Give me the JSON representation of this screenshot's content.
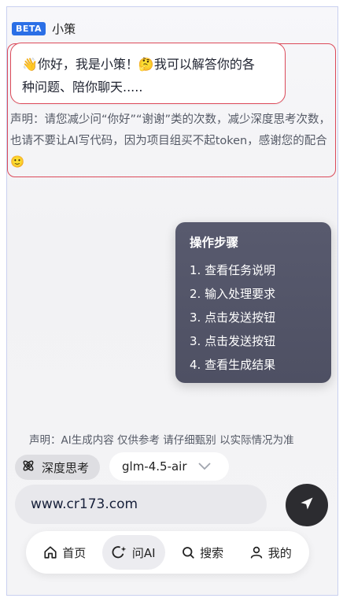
{
  "header": {
    "badge": "BETA",
    "title": "小策"
  },
  "greeting": {
    "line1": "👋你好，我是小策！🤔我可以解答你的各",
    "line2": "种问题、陪你聊天....."
  },
  "notice": {
    "text": "声明：请您减少问“你好”“谢谢”类的次数，减少深度思考次数，也请不要让AI写代码，因为项目组买不起token，感谢您的配合🙂"
  },
  "steps": {
    "title": "操作步骤",
    "items": [
      "1. 查看任务说明",
      "2. 输入处理要求",
      "3. 点击发送按钮",
      "3. 点击发送按钮",
      "4. 查看生成结果"
    ]
  },
  "footer_note": "声明：AI生成内容 仅供参考 请仔细甄别 以实际情况为准",
  "toolbar": {
    "deep_think_label": "深度思考",
    "model_value": "glm-4.5-air"
  },
  "input": {
    "value": "www.cr173.com"
  },
  "nav": {
    "items": [
      {
        "label": "首页",
        "icon": "home-icon"
      },
      {
        "label": "问AI",
        "icon": "ai-chat-icon"
      },
      {
        "label": "搜索",
        "icon": "search-icon"
      },
      {
        "label": "我的",
        "icon": "user-icon"
      }
    ],
    "active": "问AI"
  },
  "colors": {
    "accent": "#2b6fe6",
    "highlight_border": "#dc4a5a",
    "popover_bg": "#545669",
    "send_bg": "#2c2c30"
  }
}
